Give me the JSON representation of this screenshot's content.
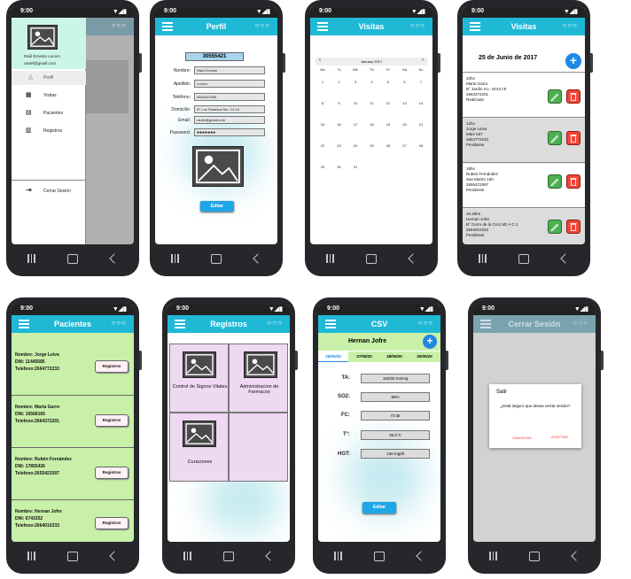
{
  "status": {
    "time": "9:00",
    "icons": "▼◢▮"
  },
  "dots": "○○○",
  "drawer": {
    "user_name": "Raúl Ernesto Lucero",
    "user_email": "raulel@gmail.com",
    "items": [
      {
        "label": "Perfil",
        "icon": "person-icon"
      },
      {
        "label": "Visitas",
        "icon": "calendar-icon"
      },
      {
        "label": "Pacientes",
        "icon": "contacts-icon"
      },
      {
        "label": "Registros",
        "icon": "clipboard-icon"
      }
    ],
    "logout": "Cerrar Sesión"
  },
  "perfil": {
    "title": "Perfil",
    "dni": "30555421",
    "fields": [
      {
        "label": "Nombre:",
        "value": "Raúl Ernesto"
      },
      {
        "label": "Apellido:",
        "value": "Lucero"
      },
      {
        "label": "Teléfono:",
        "value": "2664021555"
      },
      {
        "label": "Domicilio:",
        "value": "B° Los Paraísos Mz. 24 C6"
      },
      {
        "label": "Email:",
        "value": "raulel@gmail.com"
      },
      {
        "label": "Password:",
        "value": "●●●●●●●"
      }
    ],
    "edit_label": "Editar"
  },
  "visitas": {
    "title": "Visitas",
    "month": "January 2017",
    "weekdays": [
      "Mo",
      "Tu",
      "We",
      "Th",
      "Fr",
      "Sa",
      "Su"
    ],
    "days": [
      "1",
      "2",
      "3",
      "4",
      "5",
      "6",
      "7",
      "8",
      "9",
      "10",
      "11",
      "12",
      "13",
      "14",
      "15",
      "16",
      "17",
      "18",
      "19",
      "20",
      "21",
      "22",
      "23",
      "24",
      "25",
      "26",
      "27",
      "28",
      "29",
      "30",
      "31"
    ]
  },
  "dia": {
    "title": "Visitas",
    "date": "25 de Junio de 2017",
    "items": [
      {
        "lines": [
          "10hs",
          "Marta Garro",
          "B° Jardín S.L. M:43 c9",
          "2664372201",
          "Realizado"
        ]
      },
      {
        "lines": [
          "12hs",
          "Jorge Leiva",
          "Mitre 537",
          "2664772233",
          "Pendiente"
        ]
      },
      {
        "lines": [
          "15hs",
          "Rubén Fernández",
          "San Martín 150",
          "2655421597",
          "Pendiente"
        ]
      },
      {
        "lines": [
          "15.45hs",
          "Hernan Jofre",
          "B° Cerro de la Cruz Mz A C.1",
          "2664010233",
          "Pendiente"
        ]
      }
    ]
  },
  "pacientes": {
    "title": "Pacientes",
    "button": "Registros",
    "items": [
      {
        "nombre": "Nombre: Jorge Leiva",
        "dni": "DNI: 11445585",
        "tel": "Telefono:2664772233"
      },
      {
        "nombre": "Nombre: Marta Garro",
        "dni": "DNI: 16568165",
        "tel": "Telefono:2664372201"
      },
      {
        "nombre": "Nombre: Rubén Fernández",
        "dni": "DNI: 17855426",
        "tel": "Telefono:2655421597"
      },
      {
        "nombre": "Nombre: Hernan Jofre",
        "dni": "DNI: 6741552",
        "tel": "Telefono:2664010233"
      }
    ]
  },
  "registros": {
    "title": "Registros",
    "cells": [
      "Control de Signos Vitales",
      "Administracion de Farmacos",
      "Curaciones"
    ]
  },
  "csv": {
    "title": "CSV",
    "patient": "Hernan Jofre",
    "dates": [
      "25/05/20",
      "27/05/20",
      "28/05/20",
      "30/05/20"
    ],
    "rows": [
      {
        "label": "TA:",
        "value": "153/30 mmHg"
      },
      {
        "label": "SO2:",
        "value": "95%"
      },
      {
        "label": "FC:",
        "value": "73 lat"
      },
      {
        "label": "T°:",
        "value": "36.5°C"
      },
      {
        "label": "HGT:",
        "value": "130 mg/dl"
      }
    ],
    "edit_label": "Editar"
  },
  "cerrar": {
    "title": "Cerrar Sesión",
    "dialog_title": "Salir",
    "message": "¿Está seguro que desea cerrar sesión?",
    "cancel": "CANCELAR",
    "accept": "ACEPTAR"
  }
}
